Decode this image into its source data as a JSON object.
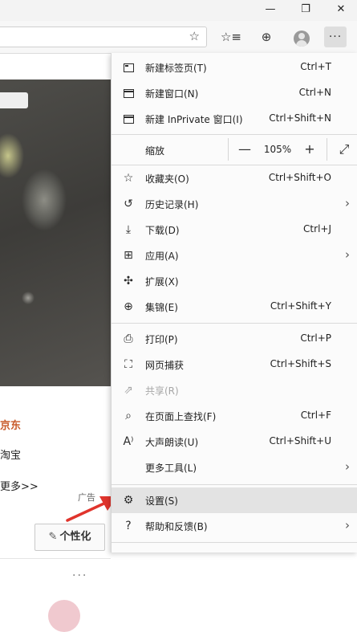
{
  "window": {
    "minimize": "—",
    "restore": "❐",
    "close": "✕"
  },
  "toolbar": {
    "address_favorite_icon": "☆",
    "favorites_icon": "☆≡",
    "collections_icon": "⊕",
    "more_label": "···"
  },
  "page": {
    "links": [
      "京东",
      "淘宝",
      "更多>>"
    ],
    "ad_label": "广告",
    "personalize_label": "个性化",
    "more_dots": "···"
  },
  "menu": {
    "items": [
      {
        "label": "新建标签页(T)",
        "shortcut": "Ctrl+T",
        "icon": "new-tab-icon"
      },
      {
        "label": "新建窗口(N)",
        "shortcut": "Ctrl+N",
        "icon": "new-window-icon"
      },
      {
        "label": "新建 InPrivate 窗口(I)",
        "shortcut": "Ctrl+Shift+N",
        "icon": "inprivate-icon"
      }
    ],
    "zoom": {
      "label": "缩放",
      "value": "105%",
      "minus": "—",
      "plus": "+",
      "fullscreen": "⤢"
    },
    "items2": [
      {
        "label": "收藏夹(O)",
        "shortcut": "Ctrl+Shift+O",
        "icon": "favorites-icon"
      },
      {
        "label": "历史记录(H)",
        "shortcut": "",
        "icon": "history-icon"
      },
      {
        "label": "下载(D)",
        "shortcut": "Ctrl+J",
        "icon": "download-icon"
      },
      {
        "label": "应用(A)",
        "shortcut": "",
        "icon": "apps-icon"
      },
      {
        "label": "扩展(X)",
        "shortcut": "",
        "icon": "extensions-icon"
      },
      {
        "label": "集锦(E)",
        "shortcut": "Ctrl+Shift+Y",
        "icon": "collections-icon"
      }
    ],
    "items3": [
      {
        "label": "打印(P)",
        "shortcut": "Ctrl+P",
        "icon": "print-icon"
      },
      {
        "label": "网页捕获",
        "shortcut": "Ctrl+Shift+S",
        "icon": "capture-icon"
      },
      {
        "label": "共享(R)",
        "shortcut": "",
        "icon": "share-icon"
      },
      {
        "label": "在页面上查找(F)",
        "shortcut": "Ctrl+F",
        "icon": "find-icon"
      },
      {
        "label": "大声朗读(U)",
        "shortcut": "Ctrl+Shift+U",
        "icon": "read-aloud-icon"
      },
      {
        "label": "更多工具(L)",
        "shortcut": "",
        "icon": "more-tools-icon"
      }
    ],
    "items4": [
      {
        "label": "设置(S)",
        "shortcut": "",
        "icon": "settings-icon"
      },
      {
        "label": "帮助和反馈(B)",
        "shortcut": "",
        "icon": "help-icon"
      }
    ],
    "chevron": "›"
  },
  "colors": {
    "accent_link": "#c85a2a",
    "highlight": "#e3e3e3",
    "arrow": "#e0342c"
  }
}
